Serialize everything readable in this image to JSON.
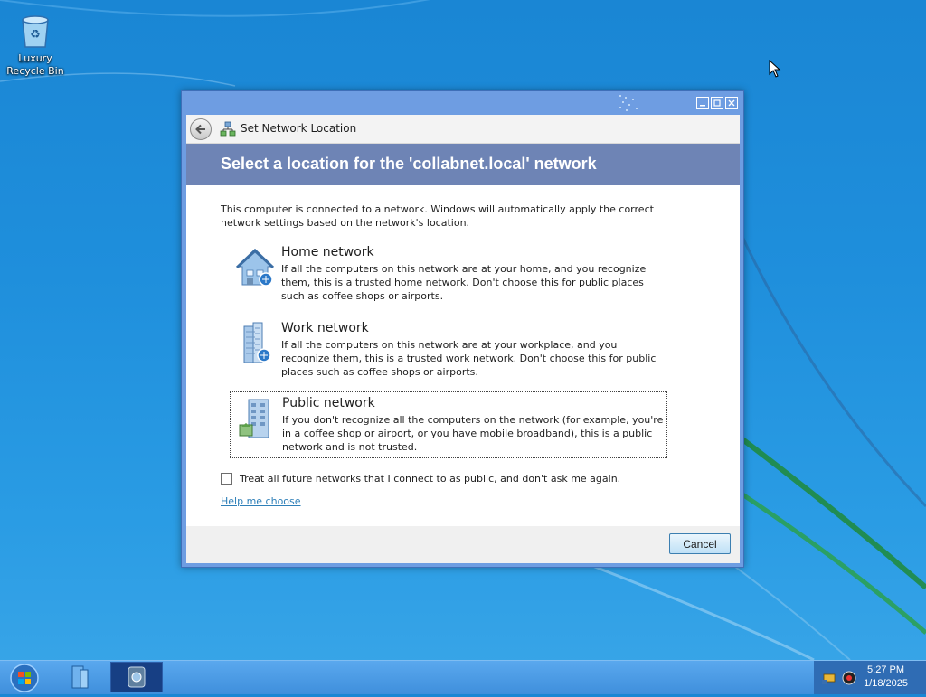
{
  "desktop": {
    "icons": [
      {
        "label": "Luxury Recycle Bin",
        "icon": "recycle-bin-icon"
      }
    ]
  },
  "window": {
    "title_icon": "network-icon",
    "title": "Set Network Location",
    "heading": "Select a location for the 'collabnet.local' network",
    "intro": "This computer is connected to a network. Windows will automatically apply the correct network settings based on the network's location.",
    "options": [
      {
        "title": "Home network",
        "description": "If all the computers on this network are at your home, and you recognize them, this is a trusted home network.  Don't choose this for public places such as coffee shops or airports.",
        "icon": "home-network-icon"
      },
      {
        "title": "Work network",
        "description": "If all the computers on this network are at your workplace, and you recognize them, this is a trusted work network.  Don't choose this for public places such as coffee shops or airports.",
        "icon": "work-network-icon"
      },
      {
        "title": "Public network",
        "description": "If you don't recognize all the computers on the network (for example, you're in a coffee shop or airport, or you have mobile broadband), this is a public network and is not trusted.",
        "icon": "public-network-icon"
      }
    ],
    "checkbox_label": "Treat all future networks that I connect to as public, and don't ask me again.",
    "checkbox_checked": false,
    "help_link": "Help me choose",
    "cancel_label": "Cancel"
  },
  "taskbar": {
    "items": [
      "start-orb",
      "file-explorer-icon",
      "network-app-icon"
    ],
    "tray_icons": [
      "network-tray-icon",
      "volume-tray-icon"
    ],
    "clock": {
      "time": "5:27 PM",
      "date": "1/18/2025"
    }
  },
  "colors": {
    "desktop_blue": "#1f8fdc",
    "window_frame": "#6e9de2",
    "banner": "#6e84b5",
    "link": "#2e7fb8"
  }
}
